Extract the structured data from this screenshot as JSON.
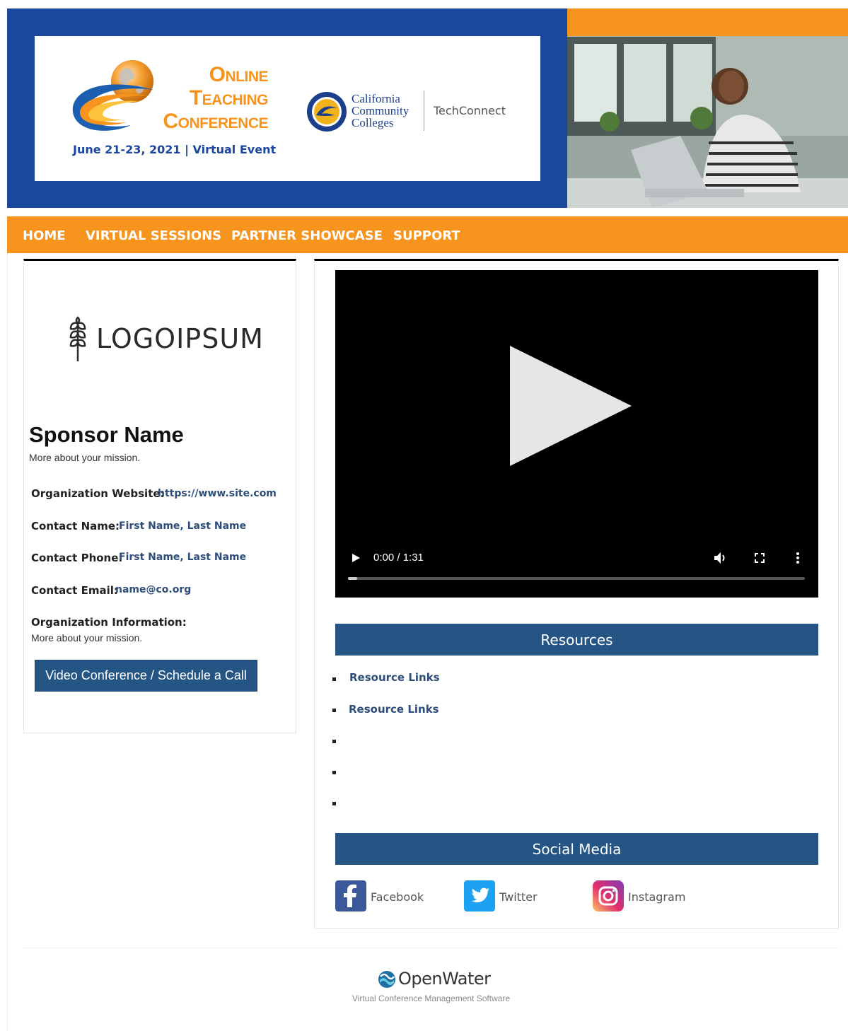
{
  "banner": {
    "conference_title_line1": "Online",
    "conference_title_line2": "Teaching",
    "conference_title_line3": "Conference",
    "conference_dates": "June 21-23, 2021 | Virtual Event",
    "partner_name_line1": "California",
    "partner_name_line2": "Community",
    "partner_name_line3": "Colleges",
    "partner_product": "TechConnect",
    "colors": {
      "blue": "#1c479e",
      "orange": "#f7941d"
    }
  },
  "nav": {
    "items": [
      {
        "label": "HOME"
      },
      {
        "label": "VIRTUAL SESSIONS"
      },
      {
        "label": "PARTNER SHOWCASE"
      },
      {
        "label": "SUPPORT"
      }
    ]
  },
  "sponsor": {
    "logo_text": "LOGOIPSUM",
    "name": "Sponsor Name",
    "mission": "More about your mission.",
    "fields": [
      {
        "label": "Organization Website:",
        "value": "https://www.site.com"
      },
      {
        "label": "Contact Name:",
        "value": "First Name, Last Name"
      },
      {
        "label": "Contact Phone:",
        "value": "First Name, Last Name"
      },
      {
        "label": "Contact Email:",
        "value": "name@co.org"
      }
    ],
    "org_info_label": "Organization Information:",
    "org_info_text": "More about your mission.",
    "schedule_button": "Video Conference / Schedule a Call"
  },
  "video": {
    "time": "0:00 / 1:31",
    "progress": 0.02
  },
  "resources": {
    "title": "Resources",
    "links": [
      "Resource Links",
      "Resource Links",
      "",
      "",
      ""
    ]
  },
  "social": {
    "title": "Social Media",
    "items": [
      {
        "label": "Facebook",
        "icon": "facebook-icon",
        "color": "#3b5998"
      },
      {
        "label": "Twitter",
        "icon": "twitter-icon",
        "color": "#1da1f2"
      },
      {
        "label": "Instagram",
        "icon": "instagram-icon",
        "color": "#c13584"
      }
    ]
  },
  "footer": {
    "brand": "OpenWater",
    "tagline": "Virtual Conference Management Software"
  },
  "theme": {
    "section_blue": "#255584"
  }
}
